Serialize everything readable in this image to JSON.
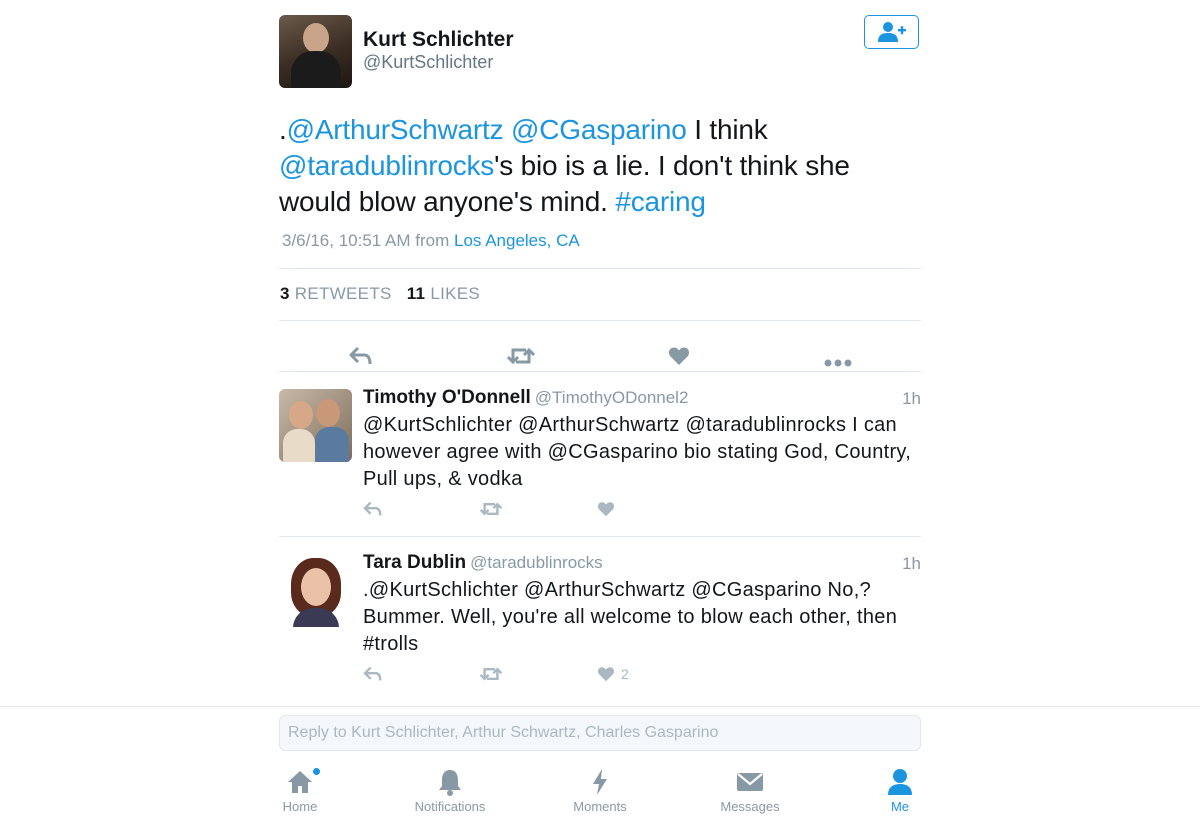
{
  "colors": {
    "link": "#1b95e0",
    "muted": "#8899a6",
    "text": "#14171a",
    "action": "#8899a6"
  },
  "main_tweet": {
    "author_name": "Kurt Schlichter",
    "author_handle": "@KurtSchlichter",
    "follow_icon": "add-user-icon",
    "text_parts": [
      {
        "text": ".",
        "type": "plain"
      },
      {
        "text": "@ArthurSchwartz",
        "type": "mention"
      },
      {
        "text": " ",
        "type": "plain"
      },
      {
        "text": "@CGasparino",
        "type": "mention"
      },
      {
        "text": " I think ",
        "type": "plain"
      },
      {
        "text": "@taradublinrocks",
        "type": "mention"
      },
      {
        "text": "'s bio is a lie. I don't think she would blow anyone's mind. ",
        "type": "plain"
      },
      {
        "text": "#caring",
        "type": "hashtag"
      }
    ],
    "timestamp": "3/6/16, 10:51 AM from",
    "location": "Los Angeles, CA",
    "retweet_count": "3",
    "retweet_label": "RETWEETS",
    "like_count": "11",
    "like_label": "LIKES",
    "actions": [
      "reply-icon",
      "retweet-icon",
      "heart-icon",
      "more-icon"
    ]
  },
  "replies": [
    {
      "name": "Timothy O'Donnell",
      "handle": "@TimothyODonnel2",
      "time": "1h",
      "lines": [
        "@KurtSchlichter @ArthurSchwartz  @taradublinrocks I can",
        "however agree with @CGasparino bio stating God, Country,",
        "Pull ups, & vodka"
      ],
      "like_count": ""
    },
    {
      "name": "Tara Dublin",
      "handle": "@taradublinrocks",
      "time": "1h",
      "lines": [
        ".@KurtSchlichter @ArthurSchwartz @CGasparino No,?",
        "Bummer. Well, you're all welcome to blow each other, then",
        "#trolls"
      ],
      "like_count": "2"
    }
  ],
  "composer": {
    "placeholder": "Reply to Kurt Schlichter, Arthur Schwartz, Charles Gasparino"
  },
  "tabs": [
    {
      "label": "Home",
      "icon": "home-icon",
      "active": false,
      "has_dot": true
    },
    {
      "label": "Notifications",
      "icon": "bell-icon",
      "active": false
    },
    {
      "label": "Moments",
      "icon": "lightning-icon",
      "active": false
    },
    {
      "label": "Messages",
      "icon": "envelope-icon",
      "active": false
    },
    {
      "label": "Me",
      "icon": "person-icon",
      "active": true
    }
  ]
}
